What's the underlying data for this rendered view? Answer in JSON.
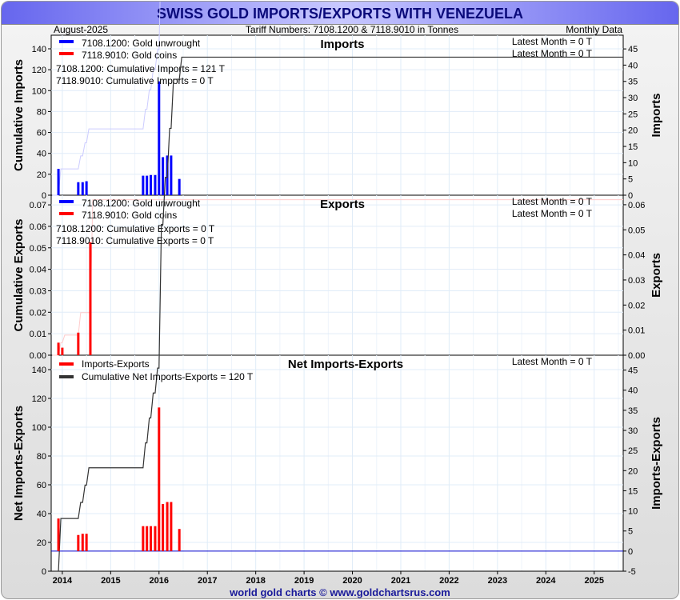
{
  "header": {
    "title": "SWISS GOLD IMPORTS/EXPORTS WITH VENEZUELA",
    "date": "August-2025",
    "tariff": "Tariff Numbers: 7108.1200 & 7118.9010 in Tonnes",
    "frequency": "Monthly Data"
  },
  "footer": "world gold charts © www.goldchartsrus.com",
  "colors": {
    "unwrought": "#0000ff",
    "coins": "#ff0000",
    "net": "#ff0000",
    "cum_net": "#333333"
  },
  "chart_data": [
    {
      "type": "bar",
      "title": "Imports",
      "ylabel": "Cumulative Imports",
      "y2label": "Imports",
      "ylim": [
        0,
        153
      ],
      "y2lim": [
        0,
        49.2
      ],
      "yticks": [
        "0",
        "20",
        "40",
        "60",
        "80",
        "100",
        "120",
        "140"
      ],
      "y2ticks": [
        "0",
        "5",
        "10",
        "15",
        "20",
        "25",
        "30",
        "35",
        "40",
        "45"
      ],
      "legend": [
        "7108.1200: Gold unwrought",
        "7118.9010: Gold coins"
      ],
      "notes": [
        "7108.1200: Cumulative Imports = 121 T",
        "7118.9010: Cumulative Imports = 0 T"
      ],
      "latest": [
        "Latest Month = 0 T",
        "Latest Month = 0 T"
      ],
      "x": [
        2013.92,
        2014.33,
        2014.42,
        2014.5,
        2015.67,
        2015.75,
        2015.83,
        2015.92,
        2016.0,
        2016.08,
        2016.17,
        2016.25,
        2016.42
      ],
      "values": [
        8.1,
        4,
        4,
        4.3,
        6,
        6,
        6.2,
        6.2,
        35,
        11.7,
        12.2,
        12.2,
        5
      ]
    },
    {
      "type": "bar",
      "title": "Exports",
      "ylabel": "Cumulative Exports",
      "y2label": "Exports",
      "ylim": [
        0,
        0.0745
      ],
      "y2lim": [
        0,
        0.0638
      ],
      "yticks": [
        "0.00",
        "0.01",
        "0.02",
        "0.03",
        "0.04",
        "0.05",
        "0.06",
        "0.07"
      ],
      "y2ticks": [
        "0.00",
        "0.01",
        "0.02",
        "0.03",
        "0.04",
        "0.05",
        "0.06"
      ],
      "legend": [
        "7108.1200: Gold unwrought",
        "7118.9010: Gold coins"
      ],
      "notes": [
        "7108.1200: Cumulative Exports = 0 T",
        "7118.9010: Cumulative Exports = 0 T"
      ],
      "latest": [
        "Latest Month = 0 T",
        "Latest Month = 0 T"
      ],
      "x": [
        2013.92,
        2014.0,
        2014.33,
        2014.58
      ],
      "values": [
        0.005,
        0.003,
        0.009,
        0.045
      ]
    },
    {
      "type": "bar",
      "title": "Net Imports-Exports",
      "ylabel": "Net Imports-Exports",
      "y2label": "Imports-Exports",
      "ylim": [
        0,
        150
      ],
      "y2lim": [
        -5,
        48.7
      ],
      "yticks": [
        "0",
        "20",
        "40",
        "60",
        "80",
        "100",
        "120",
        "140"
      ],
      "y2ticks": [
        "-5",
        "0",
        "5",
        "10",
        "15",
        "20",
        "25",
        "30",
        "35",
        "40",
        "45"
      ],
      "legend": [
        "Imports-Exports",
        "Cumulative Net Imports-Exports = 120 T"
      ],
      "latest": [
        "Latest Month = 0 T"
      ],
      "x": [
        2013.92,
        2014.33,
        2014.42,
        2014.5,
        2015.67,
        2015.75,
        2015.83,
        2015.92,
        2016.0,
        2016.08,
        2016.17,
        2016.25,
        2016.42
      ],
      "values": [
        8.1,
        4,
        4.3,
        4.3,
        6.2,
        6.2,
        6.2,
        6.2,
        35.7,
        11.7,
        12.2,
        12.2,
        5.5
      ]
    }
  ],
  "xticks": [
    "2014",
    "2015",
    "2016",
    "2017",
    "2018",
    "2019",
    "2020",
    "2021",
    "2022",
    "2023",
    "2024",
    "2025"
  ]
}
